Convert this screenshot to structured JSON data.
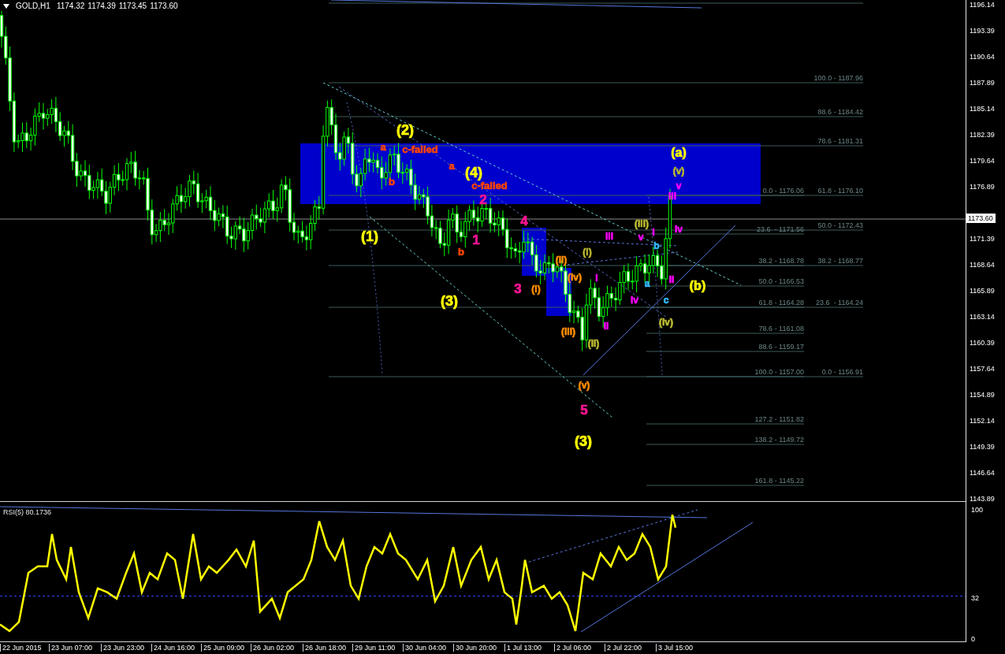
{
  "header": {
    "symbol": "GOLD,H1",
    "ohlc": [
      "1174.32",
      "1174.39",
      "1173.45",
      "1173.60"
    ]
  },
  "price_axis": {
    "labels": [
      "1196.14",
      "1193.39",
      "1190.64",
      "1187.89",
      "1185.14",
      "1182.39",
      "1179.64",
      "1176.89",
      "1171.39",
      "1168.64",
      "1165.89",
      "1163.14",
      "1160.39",
      "1157.64",
      "1154.89",
      "1152.14",
      "1149.39",
      "1146.64",
      "1143.89"
    ],
    "current_price": "1173.60"
  },
  "fib_labels": [
    "100.0 - 1187.96",
    "88.6 - 1184.42",
    "78.6 - 1181.31",
    "0.0 - 1176.06",
    "61.8 - 1176.10",
    "23.6  - 1171.56",
    "50.0 - 1172.43",
    "38.2 - 1168.78",
    "38.2 - 1168.77",
    "50.0 - 1166.53",
    "61.8 - 1164.28",
    "23.6  - 1164.24",
    "78.6 - 1161.08",
    "88.6 - 1159.17",
    "100.0 - 1157.00",
    "0.0 - 1156.91",
    "127.2 - 1151.82",
    "138.2 - 1149.72",
    "161.8 - 1145.22"
  ],
  "wave_labels": [
    {
      "text": "(2)",
      "color": "#ffff00"
    },
    {
      "text": "a",
      "color": "#ff4500"
    },
    {
      "text": "c-failed",
      "color": "#ff4500"
    },
    {
      "text": "(a)",
      "color": "#ffff00"
    },
    {
      "text": "a",
      "color": "#ff4500"
    },
    {
      "text": "(4)",
      "color": "#ffff00"
    },
    {
      "text": "(v)",
      "color": "#b8b832"
    },
    {
      "text": "b",
      "color": "#ff4500"
    },
    {
      "text": "c-failed",
      "color": "#ff4500"
    },
    {
      "text": "v",
      "color": "#ff00ff"
    },
    {
      "text": "iii",
      "color": "#ff00ff"
    },
    {
      "text": "2",
      "color": "#ff1493"
    },
    {
      "text": "4",
      "color": "#ff1493"
    },
    {
      "text": "(iii)",
      "color": "#b8b832"
    },
    {
      "text": "iv",
      "color": "#ff00ff"
    },
    {
      "text": "(1)",
      "color": "#ffff00"
    },
    {
      "text": "1",
      "color": "#ff1493"
    },
    {
      "text": "iii",
      "color": "#ff00ff"
    },
    {
      "text": "v",
      "color": "#ff00ff"
    },
    {
      "text": "i",
      "color": "#ff00ff"
    },
    {
      "text": "b",
      "color": "#33bbff"
    },
    {
      "text": "b",
      "color": "#ff4500"
    },
    {
      "text": "(i)",
      "color": "#b8b832"
    },
    {
      "text": "(ii)",
      "color": "#ff8c00"
    },
    {
      "text": "(iv)",
      "color": "#ff8c00"
    },
    {
      "text": "i",
      "color": "#ff00ff"
    },
    {
      "text": "ii",
      "color": "#ff00ff"
    },
    {
      "text": "3",
      "color": "#ff1493"
    },
    {
      "text": "(i)",
      "color": "#ff8c00"
    },
    {
      "text": "a",
      "color": "#33bbff"
    },
    {
      "text": "(b)",
      "color": "#ffff00"
    },
    {
      "text": "(3)",
      "color": "#ffff00"
    },
    {
      "text": "iv",
      "color": "#ff00ff"
    },
    {
      "text": "c",
      "color": "#33bbff"
    },
    {
      "text": "(iv)",
      "color": "#b8b832"
    },
    {
      "text": "ii",
      "color": "#ff00ff"
    },
    {
      "text": "(iii)",
      "color": "#ff8c00"
    },
    {
      "text": "(ii)",
      "color": "#b8b832"
    },
    {
      "text": "(v)",
      "color": "#ff8c00"
    },
    {
      "text": "5",
      "color": "#ff1493"
    },
    {
      "text": "(3)",
      "color": "#ffff00"
    }
  ],
  "rsi": {
    "title": "RSI(5) 80.1736",
    "axis_labels": [
      "100",
      "32",
      "0"
    ]
  },
  "time_axis": {
    "labels": [
      "22 Jun 2015",
      "23 Jun 07:00",
      "23 Jun 23:00",
      "24 Jun 16:00",
      "25 Jun 09:00",
      "26 Jun 02:00",
      "26 Jun 18:00",
      "29 Jun 11:00",
      "30 Jun 04:00",
      "30 Jun 20:00",
      "1 Jul 13:00",
      "2 Jul 06:00",
      "2 Jul 22:00",
      "3 Jul 15:00"
    ]
  }
}
